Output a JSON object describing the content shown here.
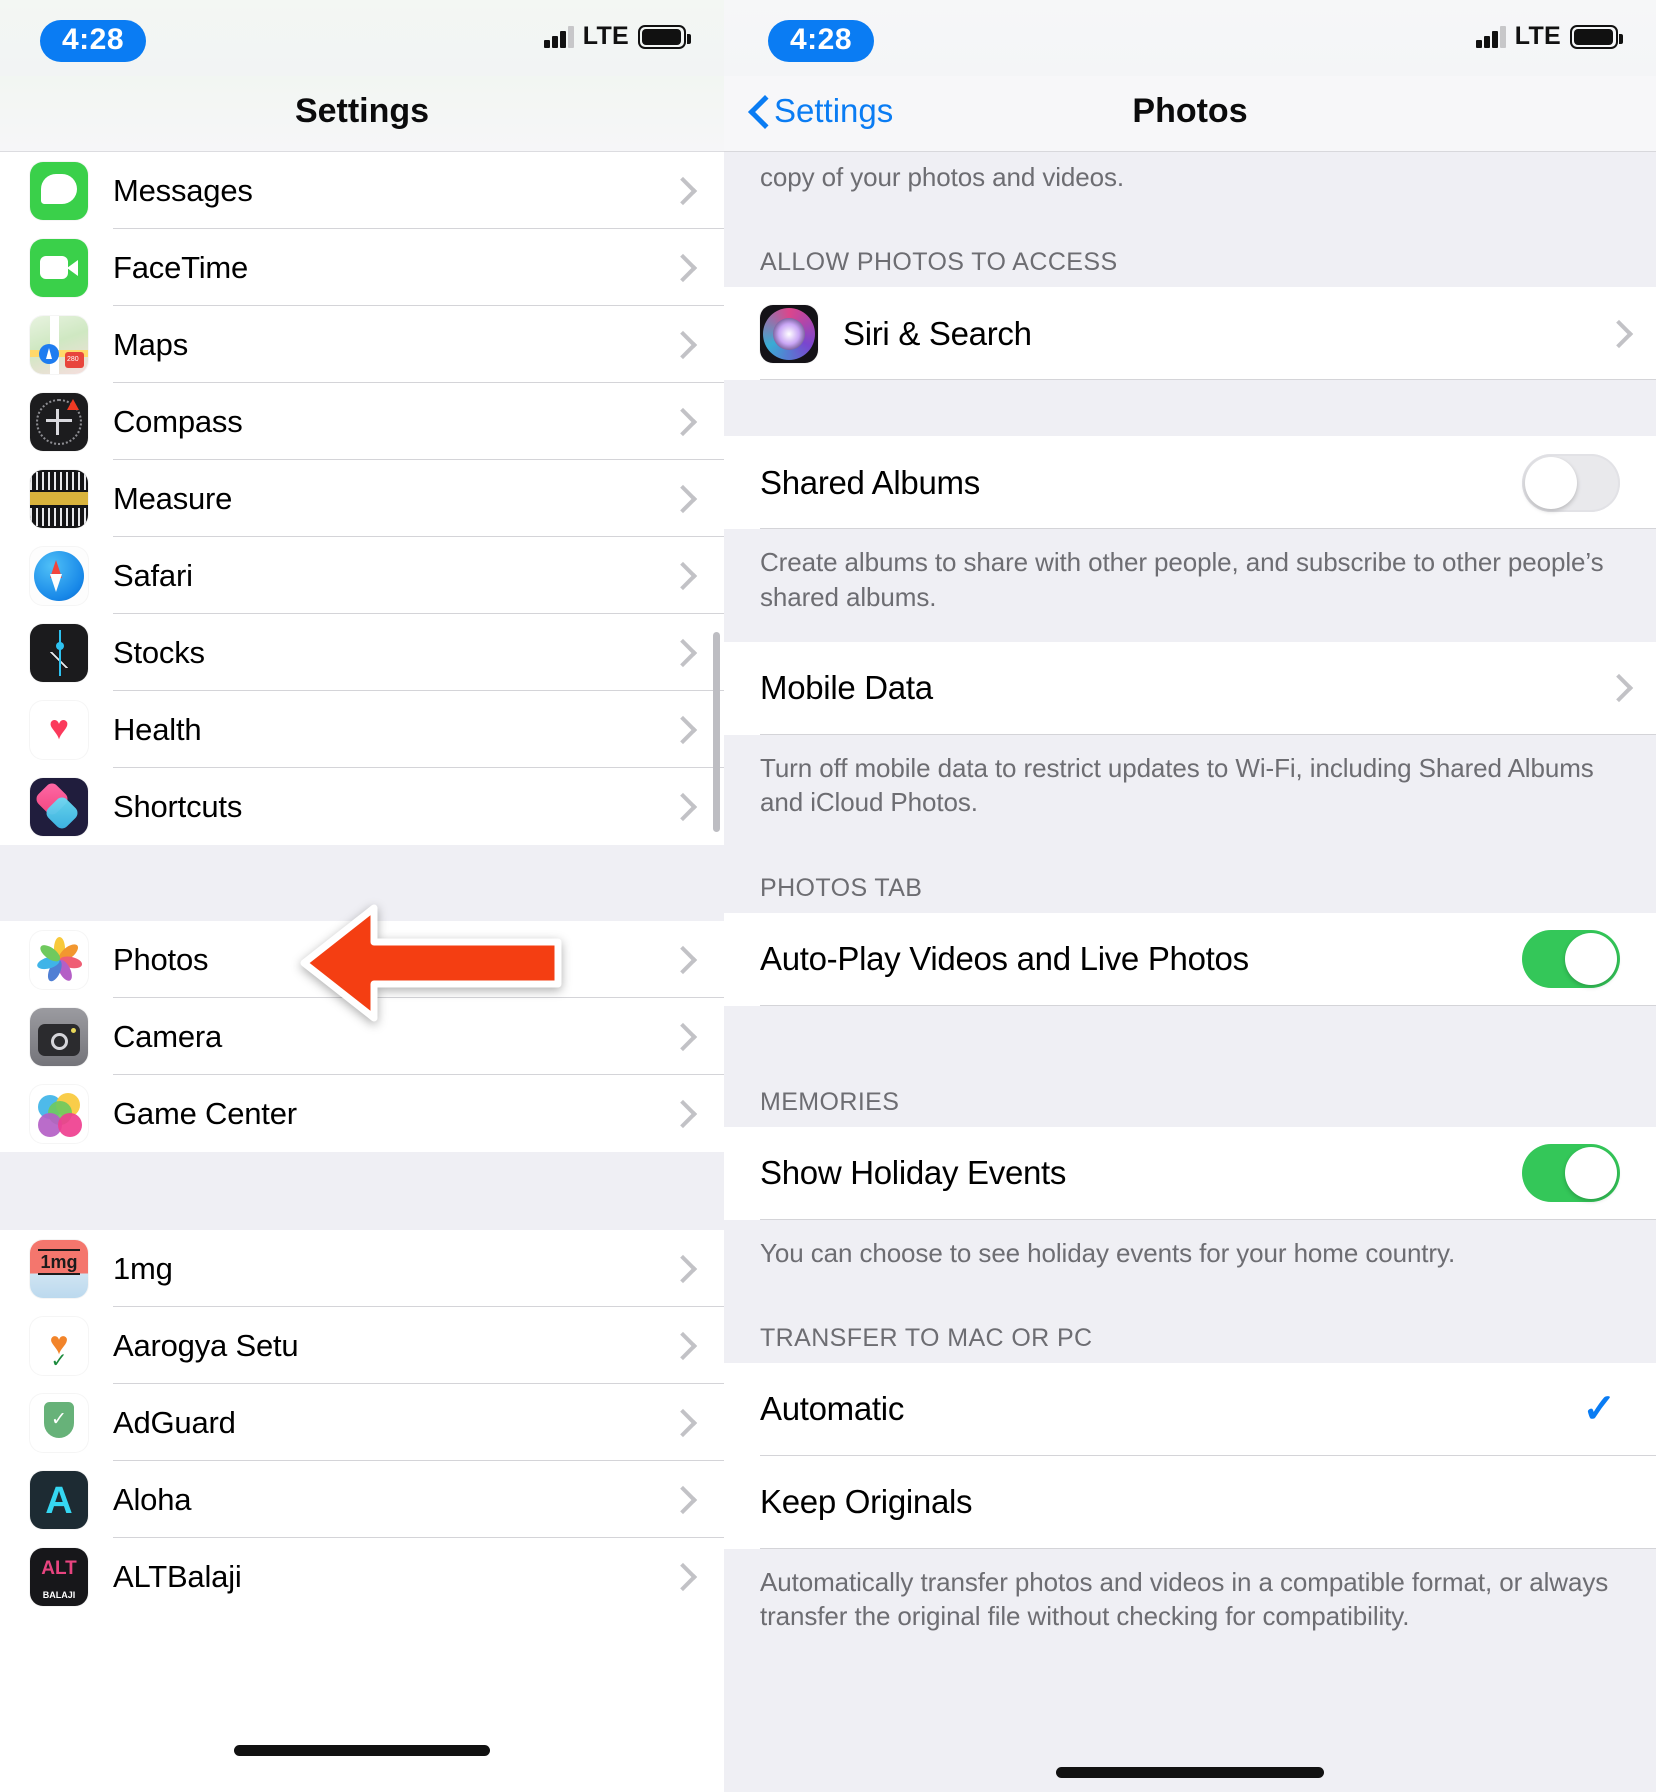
{
  "statusbar": {
    "time": "4:28",
    "network": "LTE",
    "signal_icon": "cellular-signal-icon",
    "battery_icon": "battery-icon"
  },
  "left_screen": {
    "nav": {
      "title": "Settings"
    },
    "groups": [
      {
        "items": [
          {
            "label": "Messages",
            "icon": "messages-app-icon"
          },
          {
            "label": "FaceTime",
            "icon": "facetime-app-icon"
          },
          {
            "label": "Maps",
            "icon": "maps-app-icon"
          },
          {
            "label": "Compass",
            "icon": "compass-app-icon"
          },
          {
            "label": "Measure",
            "icon": "measure-app-icon"
          },
          {
            "label": "Safari",
            "icon": "safari-app-icon"
          },
          {
            "label": "Stocks",
            "icon": "stocks-app-icon"
          },
          {
            "label": "Health",
            "icon": "health-app-icon"
          },
          {
            "label": "Shortcuts",
            "icon": "shortcuts-app-icon"
          }
        ]
      },
      {
        "items": [
          {
            "label": "Photos",
            "icon": "photos-app-icon"
          },
          {
            "label": "Camera",
            "icon": "camera-app-icon"
          },
          {
            "label": "Game Center",
            "icon": "game-center-app-icon"
          }
        ]
      },
      {
        "items": [
          {
            "label": "1mg",
            "icon": "1mg-app-icon"
          },
          {
            "label": "Aarogya Setu",
            "icon": "aarogya-setu-app-icon"
          },
          {
            "label": "AdGuard",
            "icon": "adguard-app-icon"
          },
          {
            "label": "Aloha",
            "icon": "aloha-app-icon"
          },
          {
            "label": "ALTBalaji",
            "icon": "altbalaji-app-icon"
          }
        ]
      }
    ]
  },
  "right_screen": {
    "nav": {
      "back_label": "Settings",
      "title": "Photos"
    },
    "partial_note_top": "copy of your photos and videos.",
    "sections": {
      "allow_access": {
        "header": "ALLOW PHOTOS TO ACCESS",
        "items": [
          {
            "label": "Siri & Search",
            "icon": "siri-app-icon"
          }
        ]
      },
      "shared_albums": {
        "label": "Shared Albums",
        "toggle_state": "off",
        "footer": "Create albums to share with other people, and subscribe to other people’s shared albums."
      },
      "mobile_data": {
        "label": "Mobile Data",
        "footer": "Turn off mobile data to restrict updates to Wi-Fi, including Shared Albums and iCloud Photos."
      },
      "photos_tab": {
        "header": "PHOTOS TAB",
        "label": "Auto-Play Videos and Live Photos",
        "toggle_state": "on"
      },
      "memories": {
        "header": "MEMORIES",
        "label": "Show Holiday Events",
        "toggle_state": "on",
        "footer": "You can choose to see holiday events for your home country."
      },
      "transfer": {
        "header": "TRANSFER TO MAC OR PC",
        "options": [
          {
            "label": "Automatic",
            "selected": true,
            "check": "✓"
          },
          {
            "label": "Keep Originals",
            "selected": false,
            "check": ""
          }
        ],
        "footer": "Automatically transfer photos and videos in a compatible format, or always transfer the original file without checking for compatibility."
      }
    }
  },
  "annotations": {
    "color": "#f43e12",
    "left_arrow": {
      "name": "arrow-pointing-to-photos",
      "direction": "left"
    },
    "right_arrow": {
      "name": "arrow-pointing-to-automatic",
      "direction": "right"
    }
  }
}
